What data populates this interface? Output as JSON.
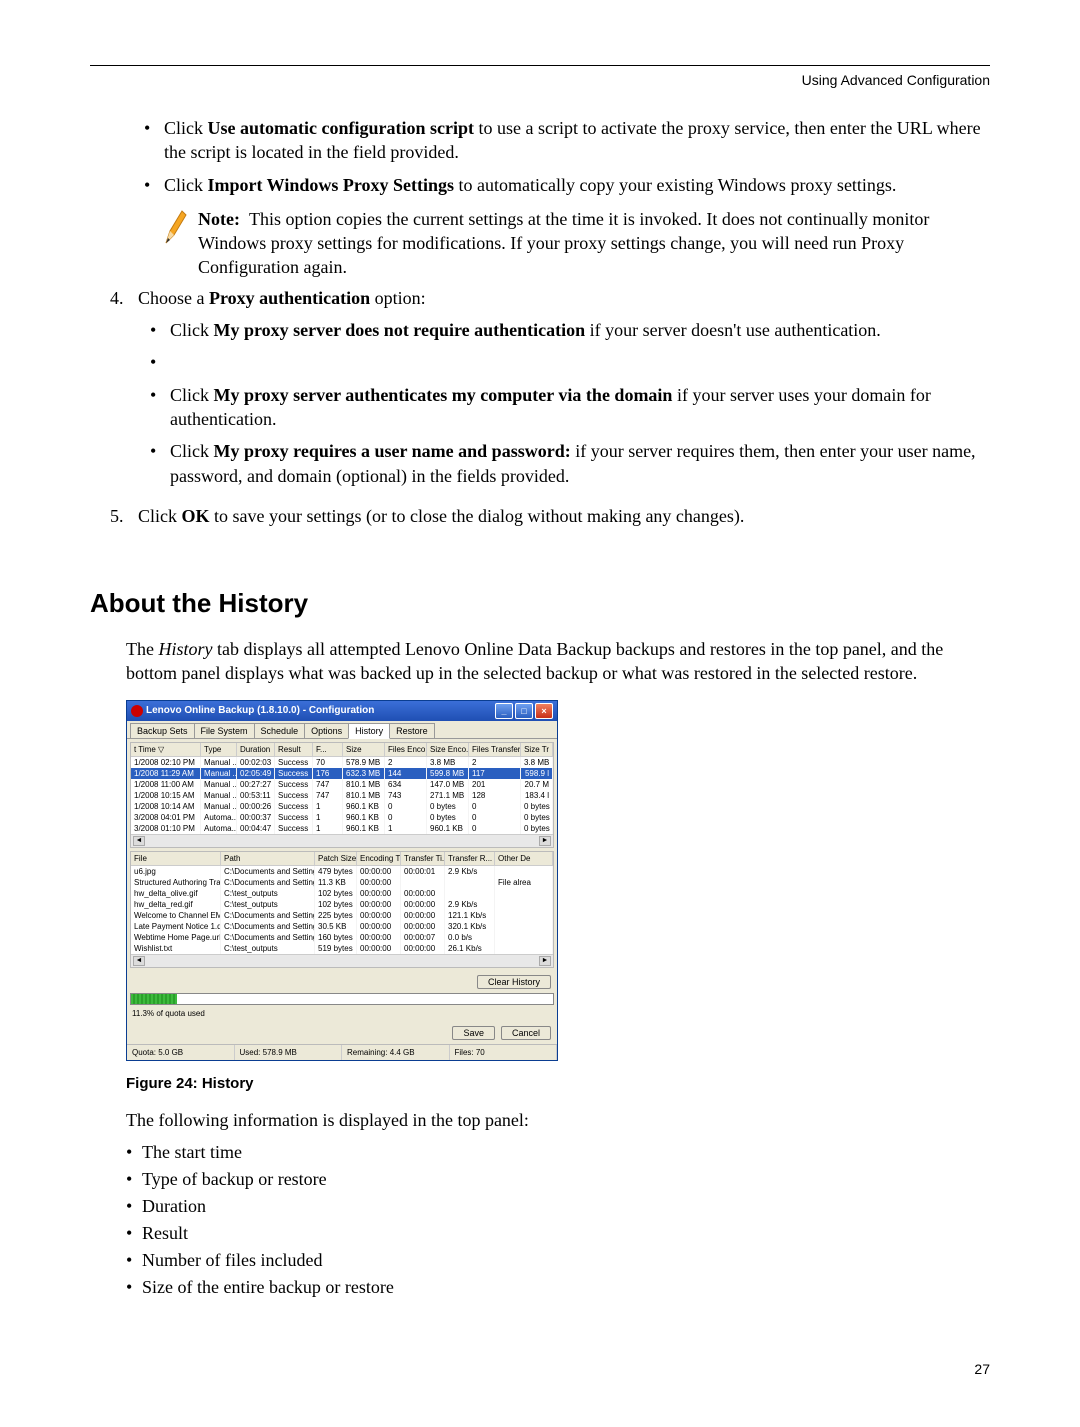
{
  "header": {
    "running_title": "Using Advanced Configuration"
  },
  "page_number": "27",
  "section": {
    "bullets_top": [
      {
        "prefix": "Click ",
        "bold": "Use automatic configuration script",
        "suffix": " to use a script to activate the proxy service, then enter the URL where the script is located in the field provided."
      },
      {
        "prefix": "Click ",
        "bold": "Import Windows Proxy Settings",
        "suffix": " to automatically copy your existing Windows proxy settings."
      }
    ],
    "note": {
      "label": "Note:",
      "text": "This option copies the current settings at the time it is invoked. It does not continually monitor Windows proxy settings for modifications. If your proxy settings change, you will need run Proxy Configuration again."
    },
    "step4": {
      "intro_prefix": "Choose a ",
      "intro_bold": "Proxy authentication",
      "intro_suffix": " option:",
      "bullets": [
        {
          "prefix": "Click ",
          "bold": "My proxy server does not require authentication",
          "suffix": " if your server doesn't use authentication."
        },
        {
          "empty": true
        },
        {
          "prefix": "Click ",
          "bold": "My proxy server authenticates my computer via the domain",
          "suffix": " if your server uses your domain for authentication."
        },
        {
          "prefix": "Click ",
          "bold": "My proxy requires a user name and password:",
          "suffix": " if your server requires them, then enter your user name, password, and domain (optional) in the fields provided."
        }
      ]
    },
    "step5": {
      "prefix": "Click ",
      "bold": "OK",
      "suffix": " to save your settings (or to close the dialog without making any changes)."
    }
  },
  "about": {
    "heading": "About the History",
    "intro_1": "The ",
    "intro_italic": "History",
    "intro_2": " tab displays all attempted Lenovo Online Data Backup backups and restores in the top panel, and the bottom panel displays what was backed up in the selected backup or what was restored in the selected restore.",
    "figure_caption": "Figure 24: History",
    "followup": "The following information is displayed in the top panel:",
    "info_list": [
      "The start time",
      "Type of backup or restore",
      "Duration",
      "Result",
      "Number of files included",
      "Size of the entire backup or restore"
    ]
  },
  "screenshot": {
    "window_title": "Lenovo Online Backup (1.8.10.0) - Configuration",
    "tabs": [
      "Backup Sets",
      "File System",
      "Schedule",
      "Options",
      "History",
      "Restore"
    ],
    "active_tab": "History",
    "top_columns": [
      "t Time ▽",
      "Type",
      "Duration",
      "Result",
      "F...",
      "Size",
      "Files Enco...",
      "Size Enco...",
      "Files Transferr...",
      "Size Tr"
    ],
    "top_rows": [
      [
        "1/2008 02:10 PM",
        "Manual ...",
        "00:02:03",
        "Success",
        "70",
        "578.9 MB",
        "2",
        "3.8 MB",
        "2",
        "3.8 MB"
      ],
      [
        "1/2008 11:29 AM",
        "Manual ...",
        "02:05:49",
        "Success",
        "176",
        "632.3 MB",
        "144",
        "599.8 MB",
        "117",
        "598.9 l"
      ],
      [
        "1/2008 11:00 AM",
        "Manual ...",
        "00:27:27",
        "Success",
        "747",
        "810.1 MB",
        "634",
        "147.0 MB",
        "201",
        "20.7 M"
      ],
      [
        "1/2008 10:15 AM",
        "Manual ...",
        "00:53:11",
        "Success",
        "747",
        "810.1 MB",
        "743",
        "271.1 MB",
        "128",
        "183.4 l"
      ],
      [
        "1/2008 10:14 AM",
        "Manual ...",
        "00:00:26",
        "Success",
        "1",
        "960.1 KB",
        "0",
        "0 bytes",
        "0",
        "0 bytes"
      ],
      [
        "3/2008 04:01 PM",
        "Automa...",
        "00:00:37",
        "Success",
        "1",
        "960.1 KB",
        "0",
        "0 bytes",
        "0",
        "0 bytes"
      ],
      [
        "3/2008 01:10 PM",
        "Automa...",
        "00:04:47",
        "Success",
        "1",
        "960.1 KB",
        "1",
        "960.1 KB",
        "0",
        "0 bytes"
      ]
    ],
    "selected_row_index": 1,
    "bottom_columns": [
      "File",
      "Path",
      "Patch Size",
      "Encoding T...",
      "Transfer Ti...",
      "Transfer R...",
      "Other De"
    ],
    "bottom_rows": [
      [
        "u6.jpg",
        "C:\\Documents and Setting...",
        "479 bytes",
        "00:00:00",
        "00:00:01",
        "2.9 Kb/s",
        ""
      ],
      [
        "Structured Authoring Traini...",
        "C:\\Documents and Setting...",
        "11.3 KB",
        "00:00:00",
        "",
        "",
        "File alrea"
      ],
      [
        "hw_delta_olive.gif",
        "C:\\test_outputs",
        "102 bytes",
        "00:00:00",
        "00:00:00",
        "",
        ""
      ],
      [
        "hw_delta_red.gif",
        "C:\\test_outputs",
        "102 bytes",
        "00:00:00",
        "00:00:00",
        "2.9 Kb/s",
        ""
      ],
      [
        "Welcome to Channel EMC.url",
        "C:\\Documents and Setting...",
        "225 bytes",
        "00:00:00",
        "00:00:00",
        "121.1 Kb/s",
        ""
      ],
      [
        "Late Payment Notice 1.doc",
        "C:\\Documents and Setting...",
        "30.5 KB",
        "00:00:00",
        "00:00:00",
        "320.1 Kb/s",
        ""
      ],
      [
        "Webtime Home Page.url",
        "C:\\Documents and Setting...",
        "160 bytes",
        "00:00:00",
        "00:00:07",
        "0.0 b/s",
        ""
      ],
      [
        "Wishlist.txt",
        "C:\\test_outputs",
        "519 bytes",
        "00:00:00",
        "00:00:00",
        "26.1 Kb/s",
        ""
      ]
    ],
    "buttons": {
      "clear_history": "Clear History",
      "save": "Save",
      "cancel": "Cancel"
    },
    "quota": {
      "label": "11.3% of quota used"
    },
    "status": {
      "quota": "Quota: 5.0 GB",
      "used": "Used: 578.9 MB",
      "remaining": "Remaining: 4.4 GB",
      "files": "Files: 70"
    }
  }
}
